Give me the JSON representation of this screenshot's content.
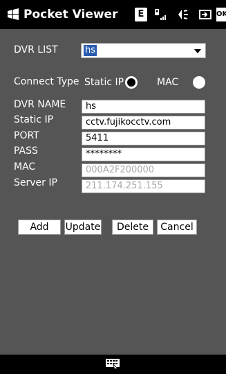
{
  "titlebar": {
    "title": "Pocket Viewer",
    "e_label": "E",
    "ok_label": "OK"
  },
  "form": {
    "dvr_list_label": "DVR LIST",
    "dvr_list_value": "hs",
    "connect_type_label": "Connect Type",
    "static_ip_option": "Static IP",
    "mac_option": "MAC",
    "selected_connect_type": "Static IP",
    "dvr_name_label": "DVR NAME",
    "dvr_name_value": "hs",
    "static_ip_label": "Static IP",
    "static_ip_value": "cctv.fujikocctv.com",
    "port_label": "PORT",
    "port_value": "5411",
    "pass_label": "PASS",
    "pass_value": "********",
    "mac_label": "MAC",
    "mac_value": "000A2F200000",
    "server_ip_label": "Server IP",
    "server_ip_value": "211.174.251.155"
  },
  "buttons": {
    "add": "Add",
    "update": "Update",
    "delete": "Delete",
    "cancel": "Cancel"
  },
  "icons": {
    "start": "windows-start-icon",
    "signal": "signal-icon",
    "volume": "volume-icon",
    "battery": "battery-icon",
    "keyboard": "keyboard-icon"
  }
}
